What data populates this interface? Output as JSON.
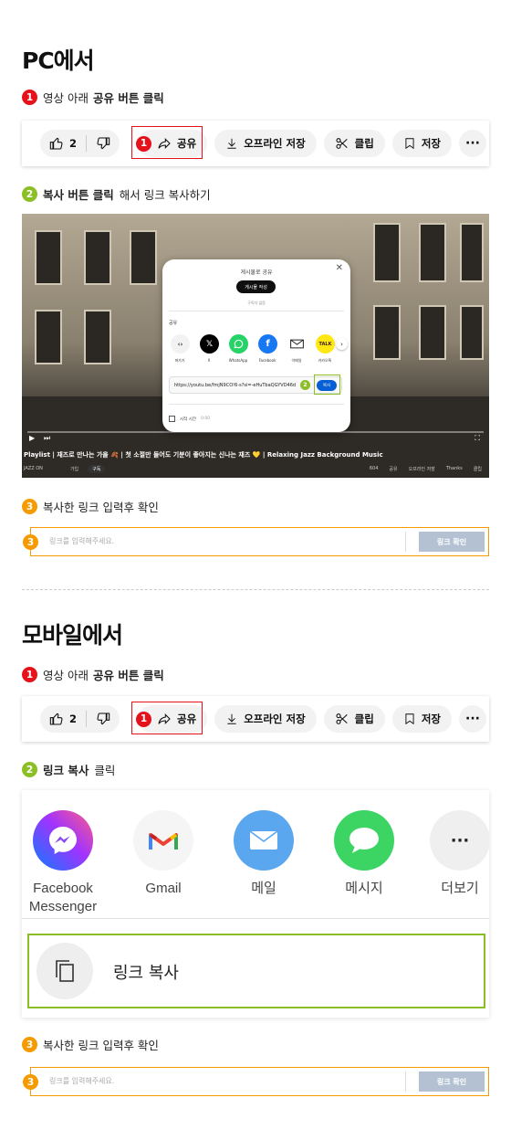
{
  "pc": {
    "title": "PC에서",
    "step1": {
      "num": "1",
      "text": "영상 아래",
      "bold": "공유 버튼 클릭"
    },
    "step2": {
      "num": "2",
      "bold": "복사 버튼 클릭",
      "text": "해서 링크 복사하기"
    },
    "step3": {
      "num": "3",
      "text": "복사한 링크 입력후 확인"
    }
  },
  "mobile": {
    "title": "모바일에서",
    "step1": {
      "num": "1",
      "text": "영상 아래",
      "bold": "공유 버튼 클릭"
    },
    "step2": {
      "num": "2",
      "bold": "링크 복사",
      "text": "클릭"
    },
    "step3": {
      "num": "3",
      "text": "복사한 링크 입력후 확인"
    }
  },
  "ytbar": {
    "like_count": "2",
    "share_marker": "1",
    "share": "공유",
    "offline_save": "오프라인 저장",
    "clip": "클립",
    "save": "저장",
    "more": "···"
  },
  "dialog": {
    "title": "게시물로 공유",
    "post_button": "게시물 작성",
    "subscribers": "구독자 없음",
    "share_label": "공유",
    "icons": [
      {
        "name": "퍼가기",
        "icon": "embed-icon",
        "color": "#f2f2f2"
      },
      {
        "name": "X",
        "icon": "x-icon",
        "color": "#000000"
      },
      {
        "name": "WhatsApp",
        "icon": "whatsapp-icon",
        "color": "#25d366"
      },
      {
        "name": "Facebook",
        "icon": "facebook-icon",
        "color": "#1877f2"
      },
      {
        "name": "이메일",
        "icon": "mail-icon",
        "color": "#ffffff"
      },
      {
        "name": "카카오톡",
        "icon": "kakaotalk-icon",
        "color": "#ffe812"
      }
    ],
    "kakao_glyph": "TALK",
    "url": "https://youtu.be/fmjN9CO!6-s?si=-eHuTbaQGYVD46d",
    "copy_marker": "2",
    "copy_button": "복사",
    "start_time": "시작 시간",
    "start_value": "0:00"
  },
  "video": {
    "title": "Playlist | 재즈로 만나는 가을 🍂 | 첫 소절만 들어도 기분이 좋아지는 신나는 재즈 💛 | Relaxing Jazz Background Music",
    "channel": "JAZZ ON",
    "join": "가입",
    "subscribe": "구독",
    "likes": "604",
    "meta": [
      "공유",
      "오프라인 저장",
      "Thanks",
      "클립"
    ]
  },
  "link_input": {
    "placeholder": "링크를 입력해주세요.",
    "confirm": "링크 확인"
  },
  "sheet": {
    "apps": [
      {
        "name": "Facebook Messenger",
        "icon": "messenger-icon",
        "color": "#a24bf2"
      },
      {
        "name": "Gmail",
        "icon": "gmail-icon",
        "color": "#f5f5f5"
      },
      {
        "name": "메일",
        "icon": "mail-icon",
        "color": "#5aa6ef"
      },
      {
        "name": "메시지",
        "icon": "message-icon",
        "color": "#3cd463"
      },
      {
        "name": "더보기",
        "icon": "more-icon",
        "color": "#efefef"
      }
    ],
    "link_copy": "링크 복사"
  },
  "colors": {
    "red": "#e5121c",
    "green": "#8cbf26",
    "orange": "#f59a00",
    "confirm_button": "#b3c1d3"
  }
}
